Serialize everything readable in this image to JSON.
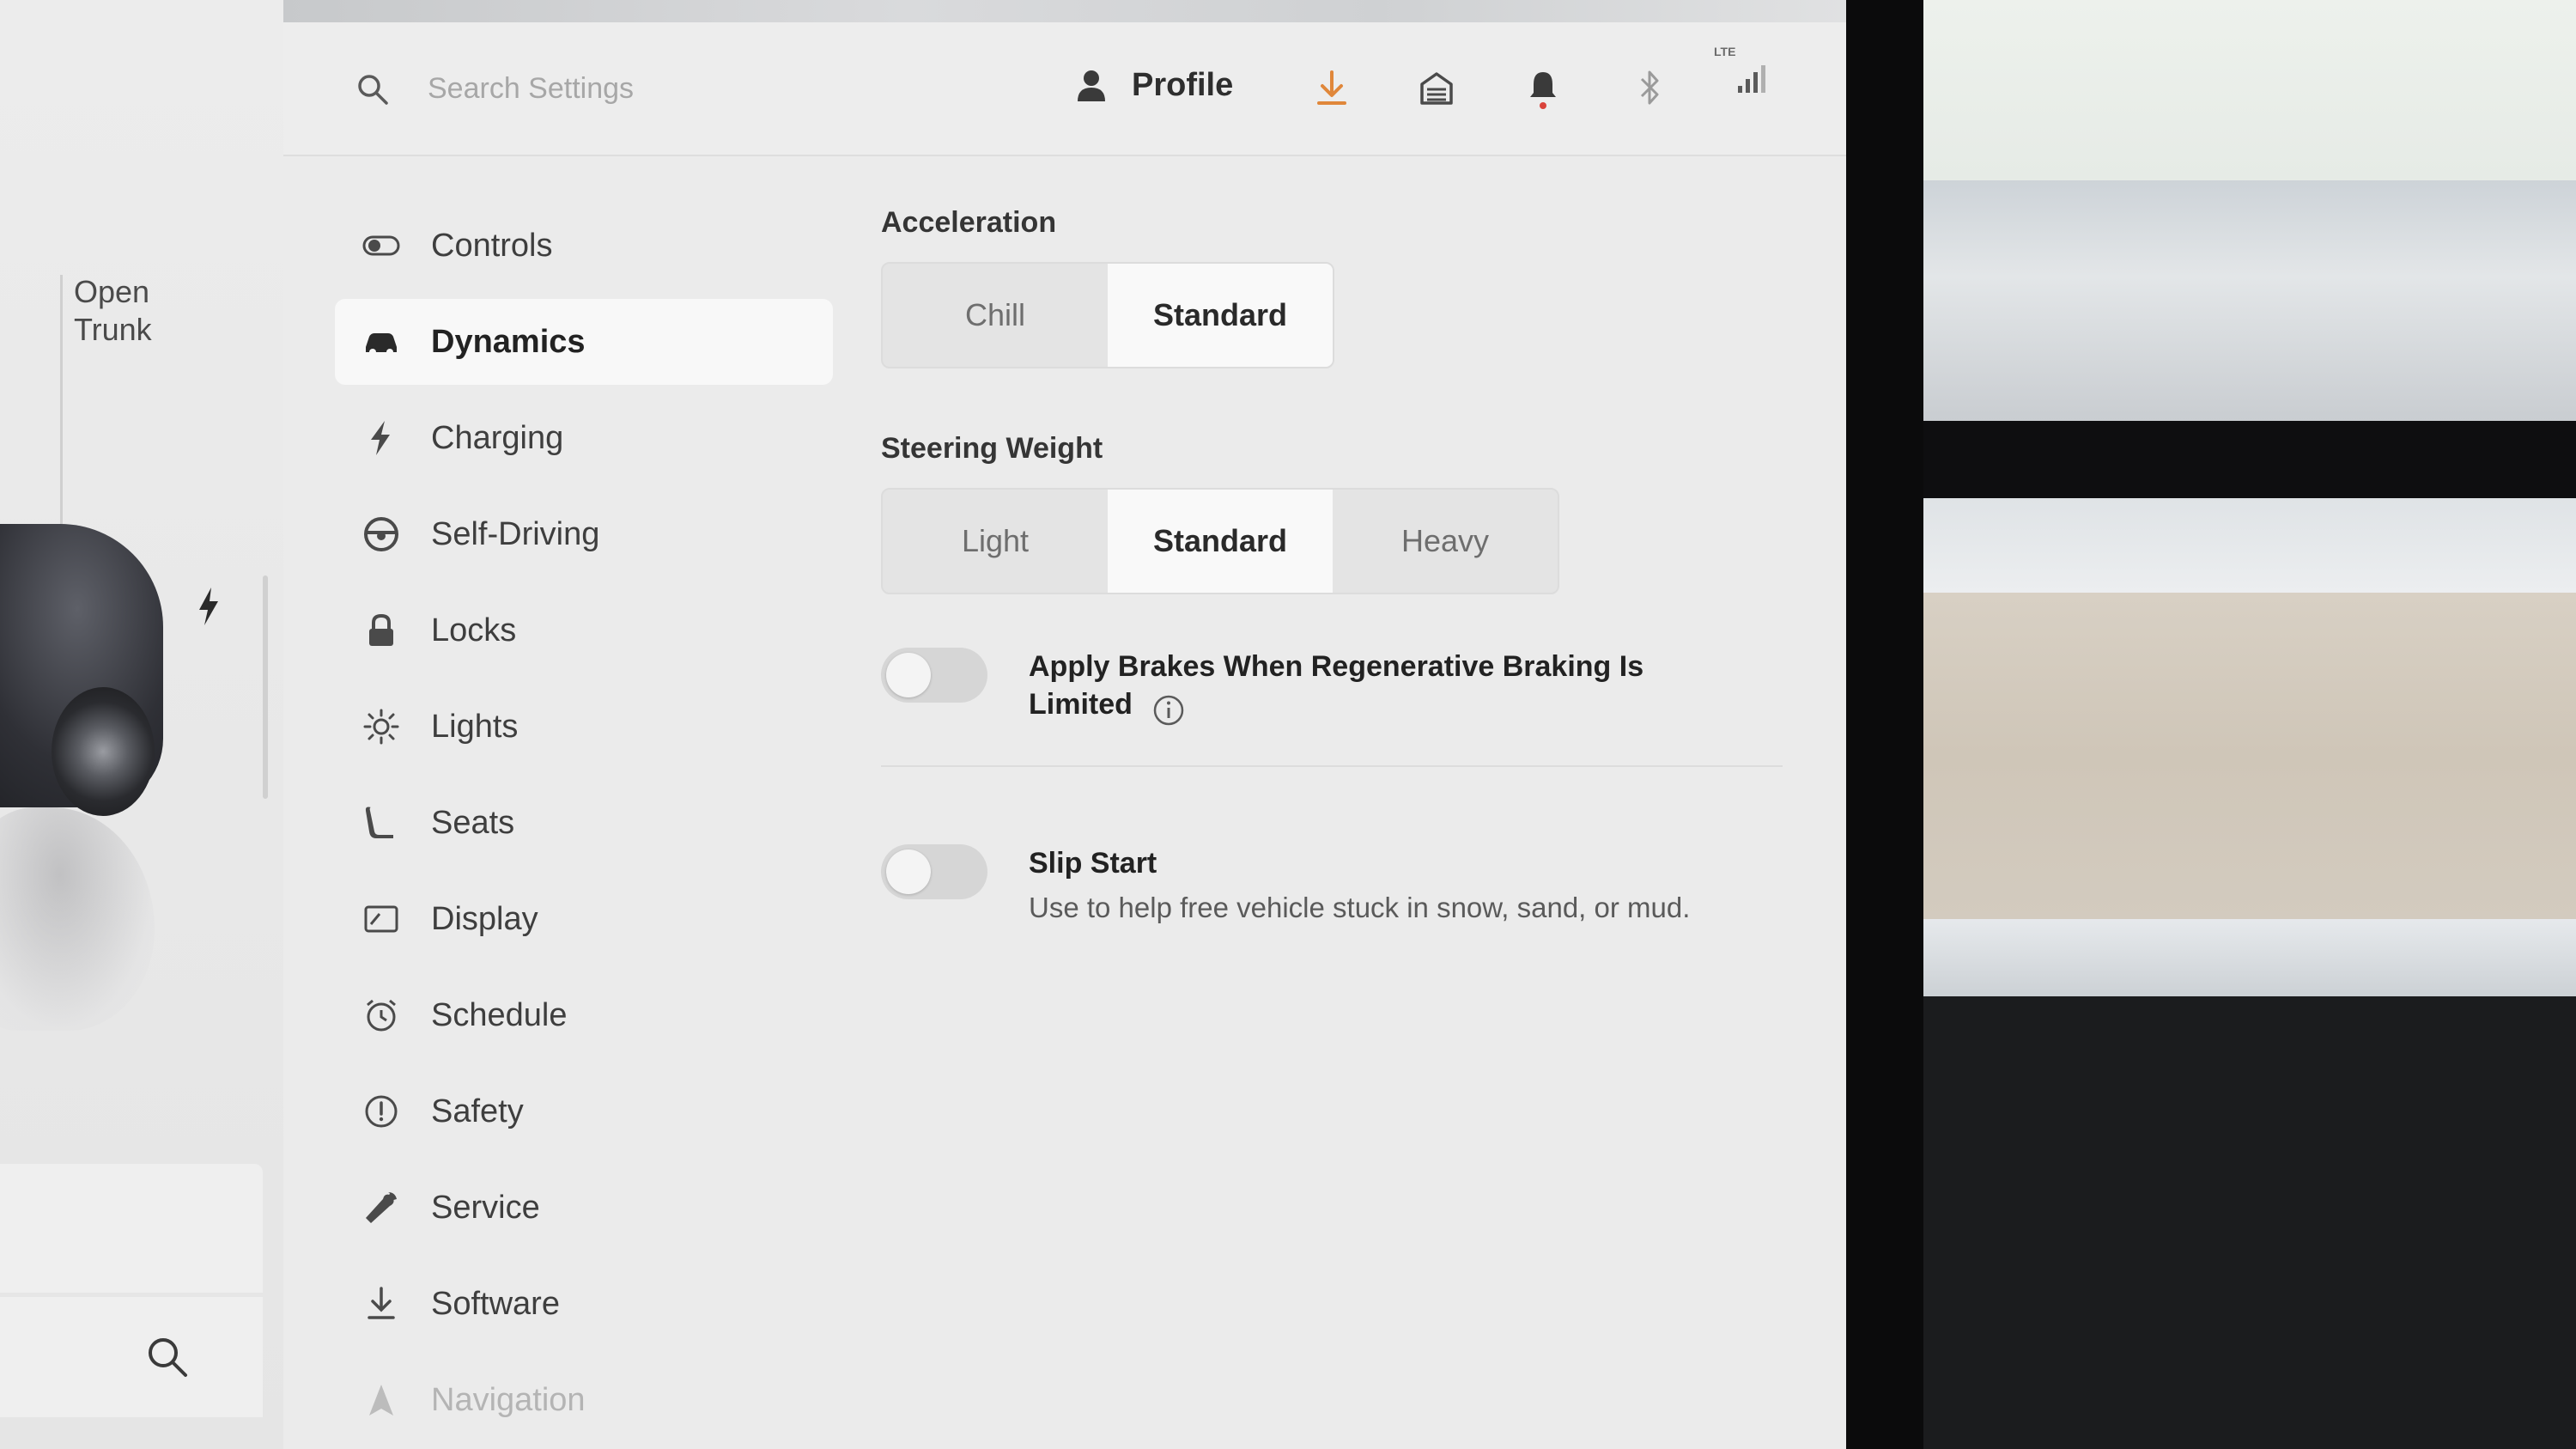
{
  "search": {
    "placeholder": "Search Settings"
  },
  "topbar": {
    "profile_label": "Profile",
    "lte_label": "LTE"
  },
  "car_panel": {
    "open_trunk": "Open\nTrunk"
  },
  "nav": {
    "items": [
      {
        "label": "Controls",
        "icon": "toggle-icon",
        "active": false
      },
      {
        "label": "Dynamics",
        "icon": "car-icon",
        "active": true
      },
      {
        "label": "Charging",
        "icon": "lightning-icon",
        "active": false
      },
      {
        "label": "Self-Driving",
        "icon": "steering-wheel-icon",
        "active": false
      },
      {
        "label": "Locks",
        "icon": "lock-icon",
        "active": false
      },
      {
        "label": "Lights",
        "icon": "sun-icon",
        "active": false
      },
      {
        "label": "Seats",
        "icon": "seat-icon",
        "active": false
      },
      {
        "label": "Display",
        "icon": "display-icon",
        "active": false
      },
      {
        "label": "Schedule",
        "icon": "alarm-clock-icon",
        "active": false
      },
      {
        "label": "Safety",
        "icon": "alert-circle-icon",
        "active": false
      },
      {
        "label": "Service",
        "icon": "wrench-icon",
        "active": false
      },
      {
        "label": "Software",
        "icon": "download-icon",
        "active": false
      },
      {
        "label": "Navigation",
        "icon": "navigation-icon",
        "active": false
      }
    ]
  },
  "acceleration": {
    "title": "Acceleration",
    "options": [
      "Chill",
      "Standard"
    ],
    "selected": "Standard"
  },
  "steering": {
    "title": "Steering Weight",
    "options": [
      "Light",
      "Standard",
      "Heavy"
    ],
    "selected": "Standard"
  },
  "regen_brakes": {
    "label": "Apply Brakes When Regenerative Braking Is Limited",
    "enabled": false
  },
  "slip_start": {
    "label": "Slip Start",
    "description": "Use to help free vehicle stuck in snow, sand, or mud.",
    "enabled": false
  },
  "colors": {
    "download_accent": "#e0873a",
    "alert_dot": "#d9433b"
  }
}
